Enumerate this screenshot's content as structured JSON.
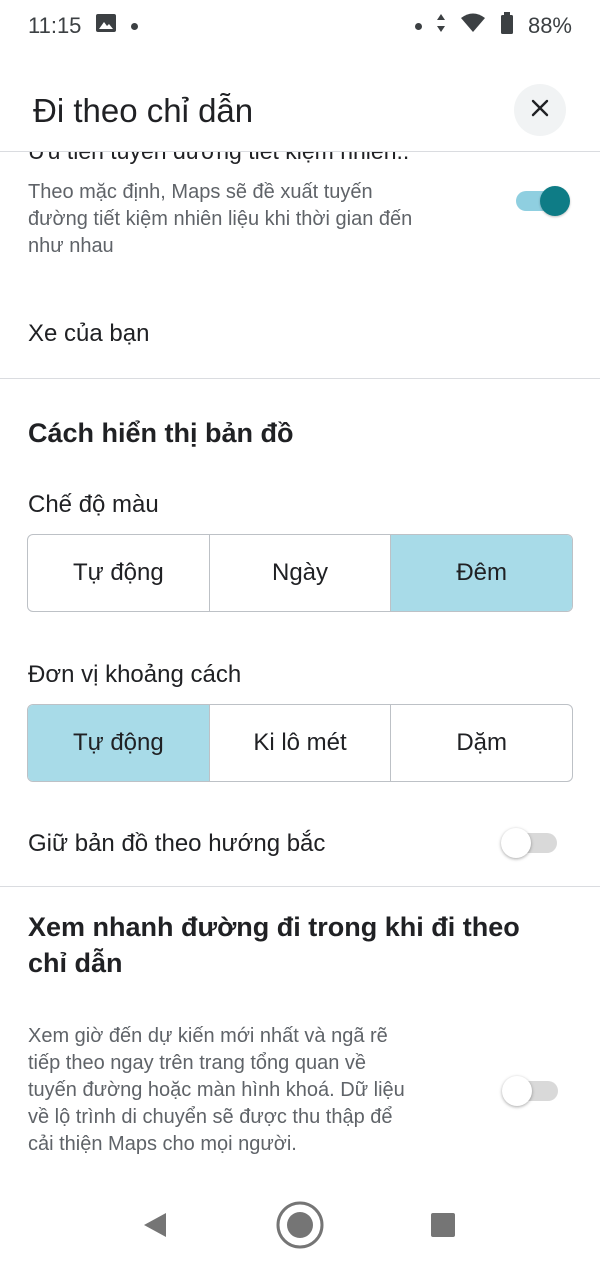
{
  "status_bar": {
    "time": "11:15",
    "battery": "88%",
    "icons": [
      "image-icon",
      "notification-dot-icon",
      "data-arrows-icon",
      "wifi-icon",
      "battery-icon"
    ]
  },
  "header": {
    "title": "Đi theo chỉ dẫn",
    "close_icon": "close-icon"
  },
  "fuel_route": {
    "title": "Ưu tiên tuyến đường tiết kiệm nhiên..",
    "description_lines": [
      "Theo mặc định, Maps sẽ đề xuất tuyến",
      "đường tiết kiệm nhiên liệu khi thời gian đến",
      "như nhau"
    ],
    "enabled": true
  },
  "your_vehicle": {
    "label": "Xe của bạn"
  },
  "map_display": {
    "title": "Cách hiển thị bản đồ",
    "color_mode": {
      "label": "Chế độ màu",
      "options": [
        "Tự động",
        "Ngày",
        "Đêm"
      ],
      "selected": "Đêm"
    },
    "distance_units": {
      "label": "Đơn vị khoảng cách",
      "options": [
        "Tự động",
        "Ki lô mét",
        "Dặm"
      ],
      "selected": "Tự động"
    },
    "north_up": {
      "label": "Giữ bản đồ theo hướng bắc",
      "enabled": false
    }
  },
  "glanceable": {
    "title_lines": [
      "Xem nhanh đường đi trong khi đi theo",
      "chỉ dẫn"
    ],
    "description_lines": [
      "Xem giờ đến dự kiến mới nhất và ngã rẽ",
      "tiếp theo ngay trên trang tổng quan về",
      "tuyến đường hoặc màn hình khoá. Dữ liệu",
      "về lộ trình di chuyển sẽ được thu thập để",
      "cải thiện Maps cho mọi người."
    ],
    "enabled": false
  },
  "colors": {
    "accent": "#0e7c86",
    "selected_segment": "#a8dbe8",
    "divider": "#dadce0"
  },
  "nav_bar": {
    "icons": [
      "back-icon",
      "home-icon",
      "recents-icon"
    ]
  }
}
